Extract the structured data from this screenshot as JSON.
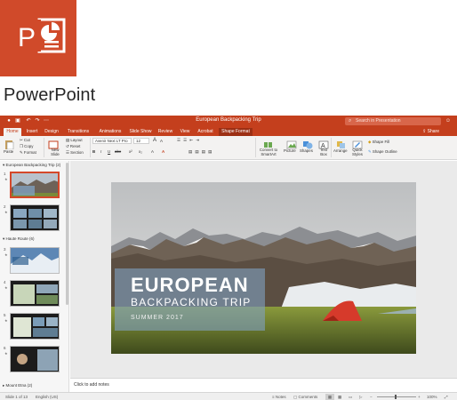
{
  "app": {
    "name": "PowerPoint",
    "logo_letter": "P",
    "brand_color": "#d04a2a"
  },
  "window": {
    "title": "European Backpacking Trip",
    "search_placeholder": "Search in Presentation",
    "title_color": "#c43f1d"
  },
  "tabs": [
    {
      "label": "Home",
      "active": true
    },
    {
      "label": "Insert"
    },
    {
      "label": "Design"
    },
    {
      "label": "Transitions"
    },
    {
      "label": "Animations"
    },
    {
      "label": "Slide Show"
    },
    {
      "label": "Review"
    },
    {
      "label": "View"
    },
    {
      "label": "Acrobat"
    },
    {
      "label": "Shape Format",
      "contextual": true
    }
  ],
  "share_label": "Share",
  "ribbon": {
    "paste": "Paste",
    "cut": "Cut",
    "copy": "Copy",
    "format": "Format",
    "new_slide": "New Slide",
    "layout": "Layout",
    "reset": "Reset",
    "section": "Section",
    "font_name": "Avenir Next LT Pro",
    "font_size": "12",
    "font_grow": "A",
    "font_shrink": "A",
    "bold": "B",
    "italic": "I",
    "underline": "U",
    "strike": "abc",
    "superscript": "x²",
    "subscript": "x₂",
    "font_color": "A",
    "convert_smartart": "Convert to SmartArt",
    "picture": "Picture",
    "shapes": "Shapes",
    "text_box": "Text Box",
    "arrange": "Arrange",
    "quick_styles": "Quick Styles",
    "shape_fill": "Shape Fill",
    "shape_outline": "Shape Outline"
  },
  "slide_panel": {
    "sections": [
      {
        "label": "European Backpacking Trip (2)"
      },
      {
        "label": "Haute Route (6)"
      },
      {
        "label": "Mount Etna (2)"
      }
    ],
    "slide_numbers": [
      "1",
      "2",
      "3",
      "4",
      "5",
      "6"
    ],
    "selected_index": 0
  },
  "slide": {
    "title": "EUROPEAN",
    "subtitle": "BACKPACKING TRIP",
    "date": "SUMMER 2017"
  },
  "notes_placeholder": "Click to add notes",
  "status": {
    "slide_counter": "Slide 1 of 13",
    "language": "English (US)",
    "notes": "Notes",
    "comments": "Comments",
    "zoom": "100%"
  }
}
